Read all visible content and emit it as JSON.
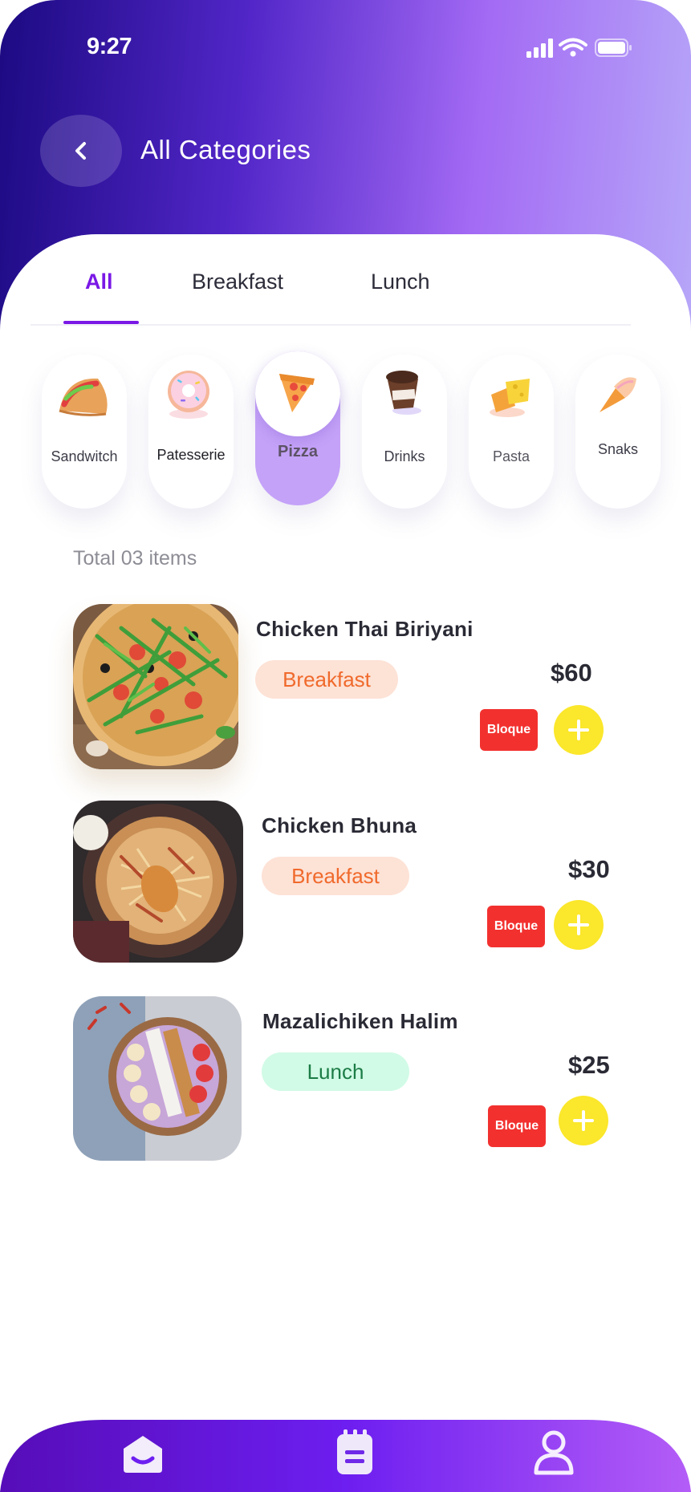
{
  "status_bar": {
    "time": "9:27"
  },
  "header": {
    "title": "All Categories"
  },
  "tabs": [
    {
      "label": "All",
      "active": true
    },
    {
      "label": "Breakfast",
      "active": false
    },
    {
      "label": "Lunch",
      "active": false
    }
  ],
  "categories": [
    {
      "label": "Sandwitch",
      "icon": "taco-icon",
      "active": false
    },
    {
      "label": "Patesserie",
      "icon": "donut-icon",
      "active": false
    },
    {
      "label": "Pizza",
      "icon": "pizza-slice-icon",
      "active": true
    },
    {
      "label": "Drinks",
      "icon": "coffee-cup-icon",
      "active": false
    },
    {
      "label": "Pasta",
      "icon": "cheese-icon",
      "active": false
    },
    {
      "label": "Snaks",
      "icon": "ice-cream-cone-icon",
      "active": false
    }
  ],
  "total_text": "Total 03 items",
  "items": [
    {
      "name": "Chicken Thai Biriyani",
      "tag": "Breakfast",
      "price": "$60",
      "action_label": "Bloque",
      "image": "pizza-photo"
    },
    {
      "name": "Chicken Bhuna",
      "tag": "Breakfast",
      "price": "$30",
      "action_label": "Bloque",
      "image": "biryani-photo"
    },
    {
      "name": "Mazalichiken Halim",
      "tag": "Lunch",
      "price": "$25",
      "action_label": "Bloque",
      "image": "smoothie-bowl-photo"
    }
  ],
  "colors": {
    "accent": "#7a18e6",
    "active_category": "#c4a2f8",
    "add_button": "#fbe72b",
    "bloque_button": "#f2312f",
    "breakfast_tag_bg": "#fde2d6",
    "breakfast_tag_text": "#f06a2c",
    "lunch_tag_bg": "#d1fbe6",
    "lunch_tag_text": "#1c7c46"
  },
  "bottom_nav": [
    {
      "icon": "home-icon"
    },
    {
      "icon": "notepad-icon"
    },
    {
      "icon": "profile-icon"
    }
  ]
}
